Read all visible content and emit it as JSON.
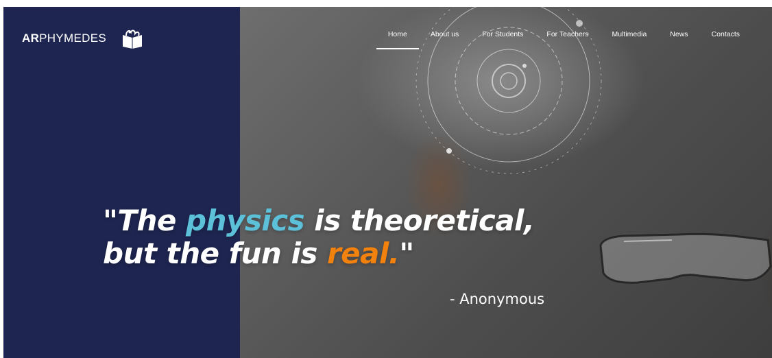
{
  "brand": {
    "name_strong": "AR",
    "name_rest": "PHYMEDES",
    "logo_icon": "open-book-icon"
  },
  "nav": {
    "items": [
      {
        "label": "Home",
        "active": true
      },
      {
        "label": "About us",
        "active": false
      },
      {
        "label": "For Students",
        "active": false
      },
      {
        "label": "For Teachers",
        "active": false
      },
      {
        "label": "Multimedia",
        "active": false
      },
      {
        "label": "News",
        "active": false
      },
      {
        "label": "Contacts",
        "active": false
      }
    ]
  },
  "hero": {
    "quote": {
      "open": "\"The ",
      "highlight_1": "physics",
      "middle": " is theoretical,",
      "line2_start": "but the fun is ",
      "highlight_2": "real.",
      "close": "\""
    },
    "attribution": "- Anonymous"
  },
  "colors": {
    "panel": "#1e2550",
    "accent_blue": "#5bc0d8",
    "accent_orange": "#f2820d",
    "text": "#ffffff"
  }
}
